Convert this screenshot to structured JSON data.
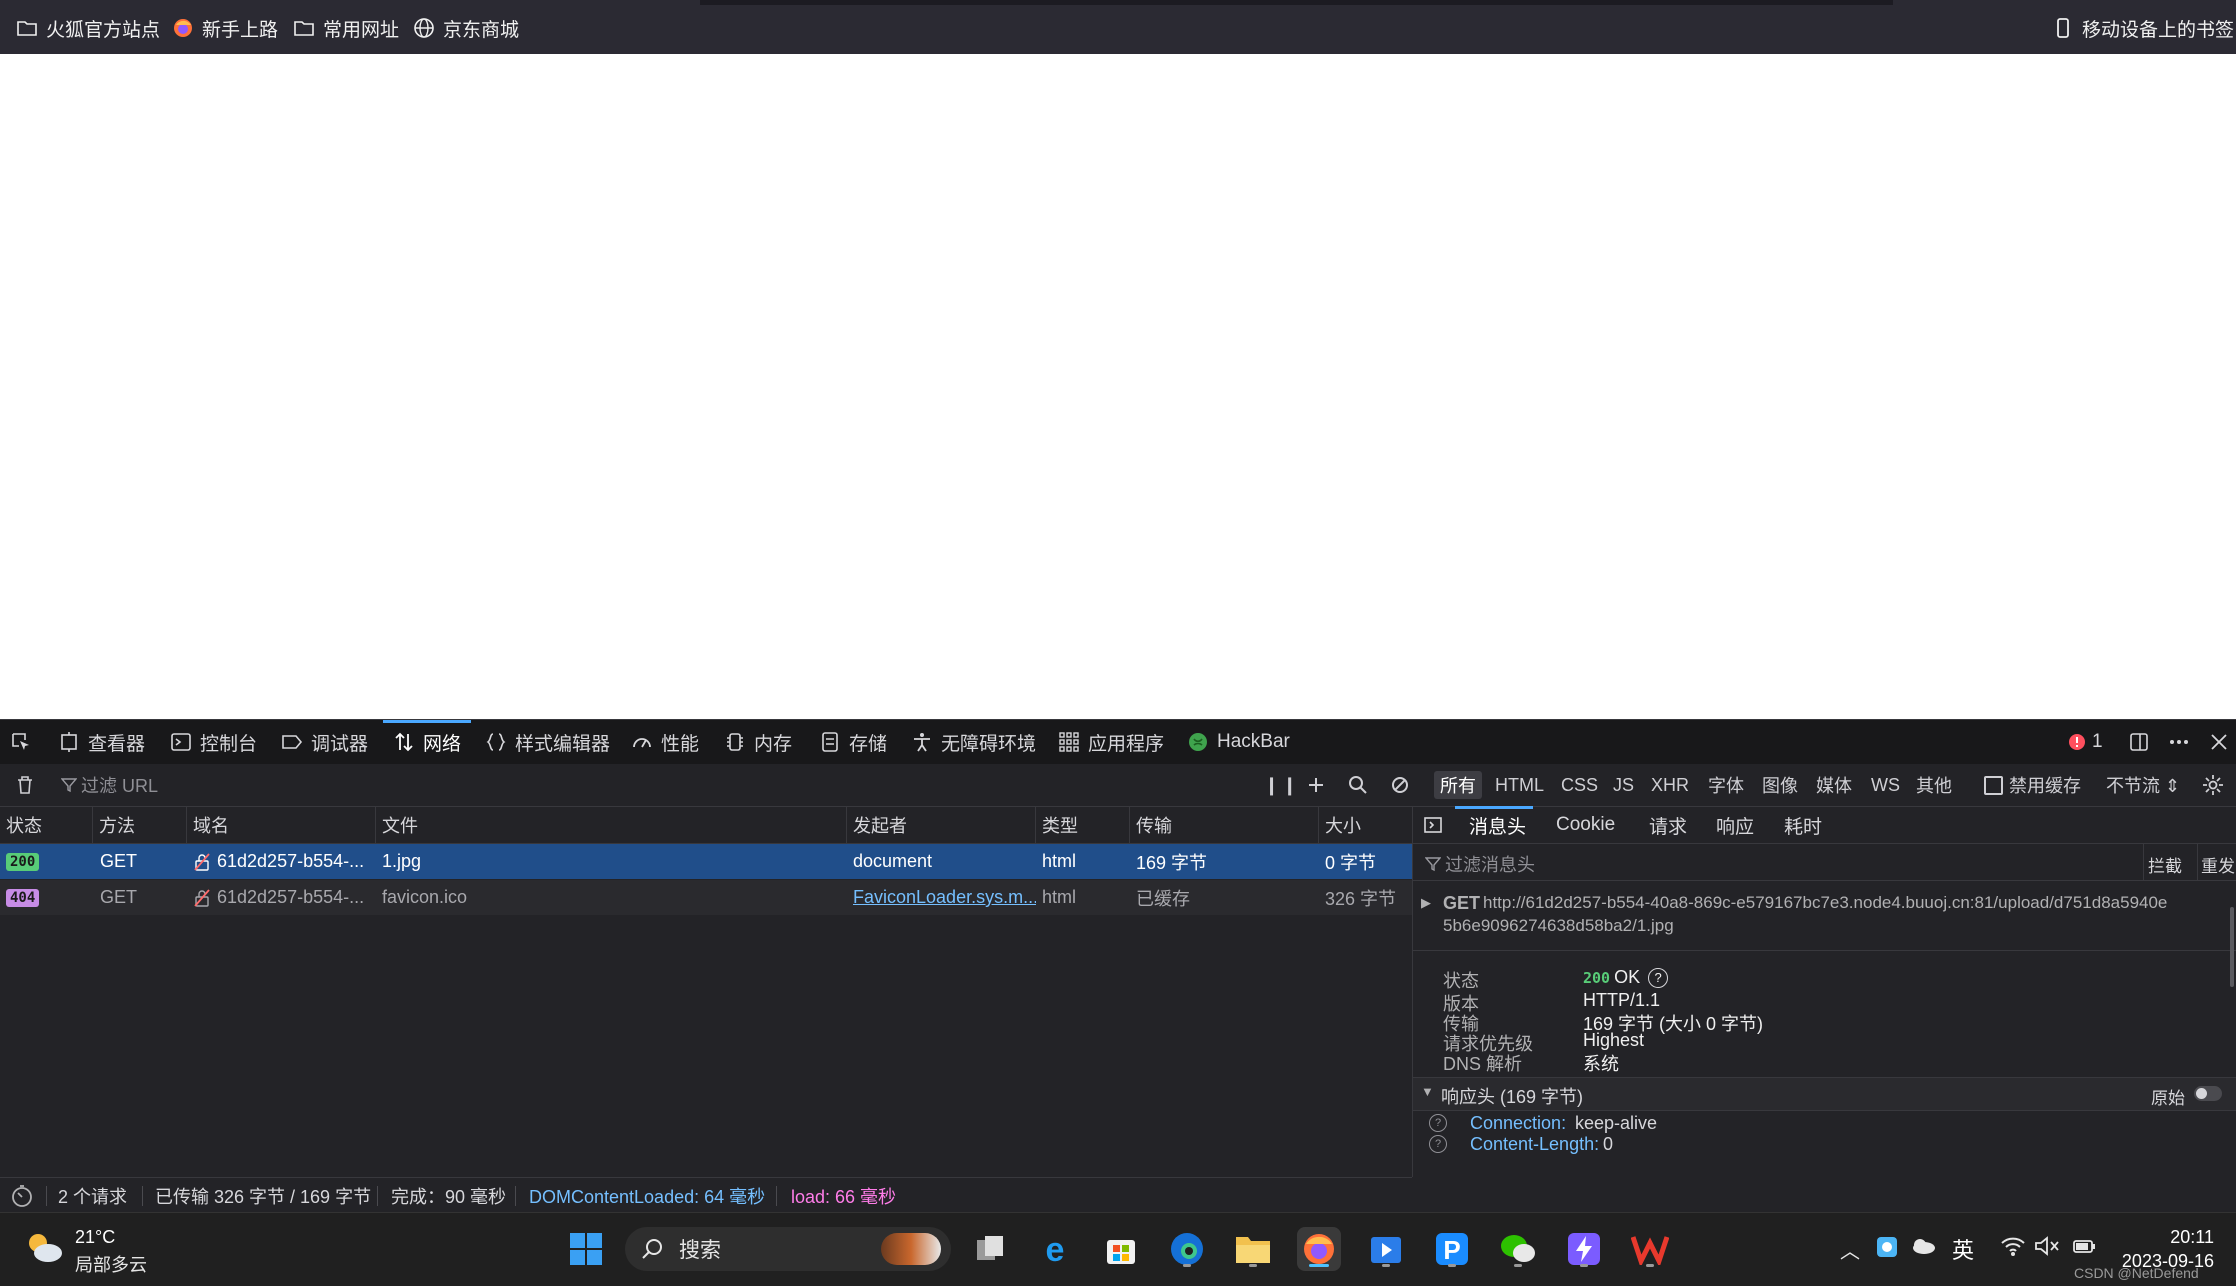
{
  "bookmarks": {
    "items": [
      {
        "label": "火狐官方站点",
        "icon": "folder-icon"
      },
      {
        "label": "新手上路",
        "icon": "firefox-icon"
      },
      {
        "label": "常用网址",
        "icon": "folder-icon"
      },
      {
        "label": "京东商城",
        "icon": "globe-icon"
      }
    ],
    "mobile": "移动设备上的书签"
  },
  "devtools": {
    "tabs": [
      {
        "label": "查看器",
        "icon": "inspector-icon"
      },
      {
        "label": "控制台",
        "icon": "console-icon"
      },
      {
        "label": "调试器",
        "icon": "debugger-icon"
      },
      {
        "label": "网络",
        "icon": "network-icon",
        "active": true
      },
      {
        "label": "样式编辑器",
        "icon": "braces-icon"
      },
      {
        "label": "性能",
        "icon": "gauge-icon"
      },
      {
        "label": "内存",
        "icon": "memory-icon"
      },
      {
        "label": "存储",
        "icon": "storage-icon"
      },
      {
        "label": "无障碍环境",
        "icon": "accessibility-icon"
      },
      {
        "label": "应用程序",
        "icon": "grid-icon"
      },
      {
        "label": "HackBar",
        "icon": "hackbar-icon"
      }
    ],
    "error_count": "1"
  },
  "net_toolbar": {
    "filter_placeholder": "过滤 URL",
    "types": [
      "所有",
      "HTML",
      "CSS",
      "JS",
      "XHR",
      "字体",
      "图像",
      "媒体",
      "WS",
      "其他"
    ],
    "disable_cache": "禁用缓存",
    "throttle": "不节流 ⇕"
  },
  "table": {
    "headers": [
      "状态",
      "方法",
      "域名",
      "文件",
      "发起者",
      "类型",
      "传输",
      "大小"
    ],
    "rows": [
      {
        "status": "200",
        "method": "GET",
        "domain": "61d2d257-b554-...",
        "file": "1.jpg",
        "initiator": "document",
        "type": "html",
        "transfer": "169 字节",
        "size": "0 字节",
        "selected": true
      },
      {
        "status": "404",
        "method": "GET",
        "domain": "61d2d257-b554-...",
        "file": "favicon.ico",
        "initiator": "FaviconLoader.sys.m...",
        "type": "html",
        "transfer": "已缓存",
        "size": "326 字节",
        "selected": false
      }
    ]
  },
  "status_bar": {
    "requests": "2 个请求",
    "transferred": "已传输 326 字节 / 169 字节",
    "finish": "完成：90 毫秒",
    "dcl": "DOMContentLoaded: 64 毫秒",
    "load": "load: 66 毫秒"
  },
  "side": {
    "tabs": [
      "消息头",
      "Cookie",
      "请求",
      "响应",
      "耗时"
    ],
    "filter_placeholder": "过滤消息头",
    "block": "拦截",
    "resend": "重发",
    "request_method": "GET",
    "request_url_line1": "http://61d2d257-b554-40a8-869c-e579167bc7e3.node4.buuoj.cn:81/upload/d751d8a5940e",
    "request_url_line2": "5b6e9096274638d58ba2/1.jpg",
    "status_label": "状态",
    "status_code": "200",
    "status_text": "OK",
    "version_label": "版本",
    "version": "HTTP/1.1",
    "transfer_label": "传输",
    "transfer": "169 字节 (大小 0 字节)",
    "priority_label": "请求优先级",
    "priority": "Highest",
    "dns_label": "DNS 解析",
    "dns": "系统",
    "resp_headers": "响应头 (169 字节)",
    "raw": "原始",
    "headers": [
      {
        "name": "Connection:",
        "value": "keep-alive"
      },
      {
        "name": "Content-Length:",
        "value": "0"
      }
    ]
  },
  "taskbar": {
    "weather_temp": "21°C",
    "weather_desc": "局部多云",
    "search": "搜索",
    "ime": "英",
    "time": "20:11",
    "date": "2023-09-16",
    "watermark": "CSDN @NetDefend"
  }
}
